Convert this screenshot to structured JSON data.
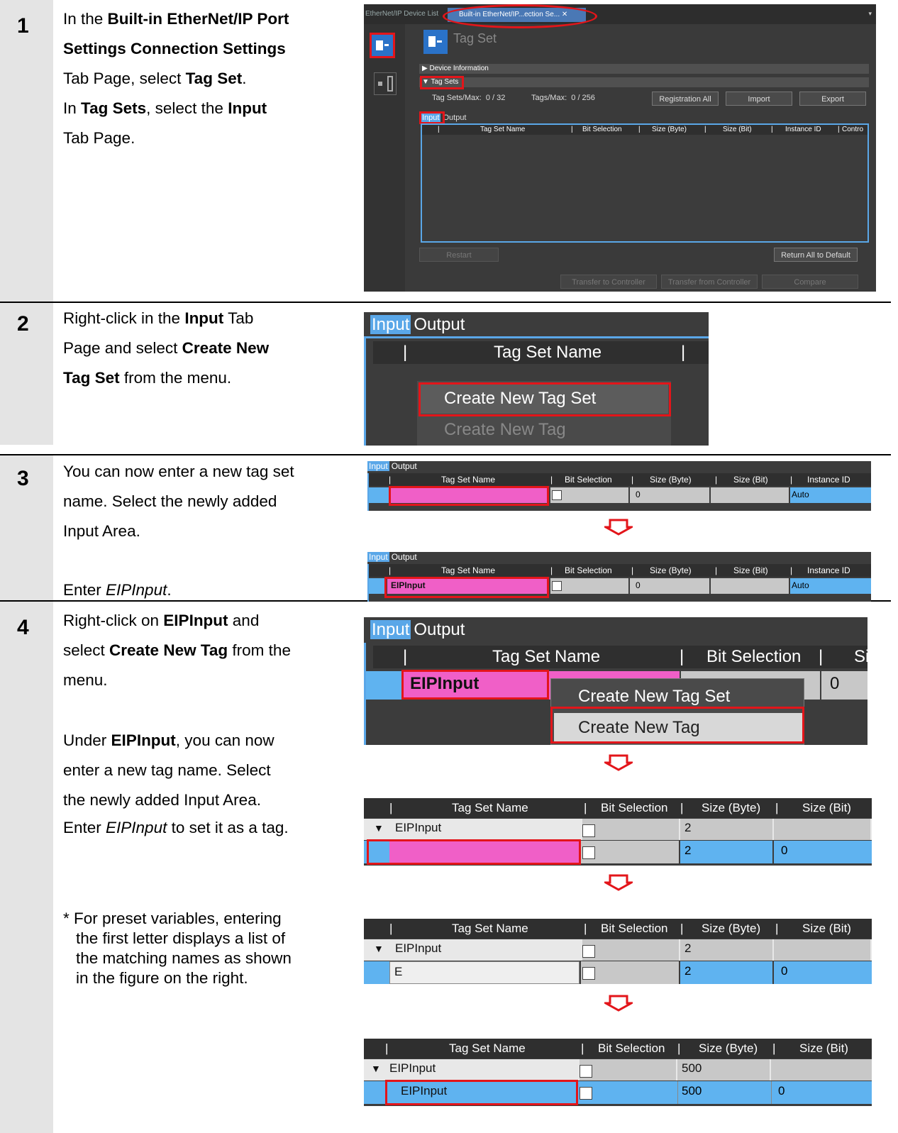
{
  "steps": [
    {
      "num": "1"
    },
    {
      "num": "2"
    },
    {
      "num": "3"
    },
    {
      "num": "4"
    }
  ],
  "step1": {
    "line1_a": "In the ",
    "line1_b": "Built-in EtherNet/IP Port",
    "line2": "Settings Connection Settings",
    "line3_a": "Tab Page, select ",
    "line3_b": "Tag Set",
    "line3_c": ".",
    "line4_a": "In ",
    "line4_b": "Tag Sets",
    "line4_c": ", select the ",
    "line4_d": "Input",
    "line5": "Tab Page."
  },
  "step2": {
    "line1_a": "Right-click in the ",
    "line1_b": "Input",
    "line1_c": " Tab",
    "line2_a": "Page and select ",
    "line2_b": "Create New",
    "line3_a": "Tag Set",
    "line3_b": " from the menu."
  },
  "step3": {
    "line1": "You can now enter a new tag set",
    "line2": "name. Select the newly added",
    "line3": "Input Area.",
    "line4_a": "Enter ",
    "line4_b": "EIPInput",
    "line4_c": "."
  },
  "step4": {
    "line1_a": "Right-click on ",
    "line1_b": "EIPInput",
    "line1_c": " and",
    "line2_a": "select ",
    "line2_b": "Create New Tag",
    "line2_c": " from the",
    "line3": "menu.",
    "line4_a": "Under ",
    "line4_b": "EIPInput",
    "line4_c": ", you can now",
    "line5": "enter a new tag name. Select",
    "line6": "the newly added Input Area.",
    "line7_a": "Enter ",
    "line7_b": "EIPInput",
    "line7_c": " to set it as a tag.",
    "note1": "* For preset variables, entering",
    "note2": "  the first letter displays a list of",
    "note3": "  the matching names as shown",
    "note4": "  in the figure on the right."
  },
  "sysmac": {
    "tab1": "EtherNet/IP Device List",
    "tab2": "Built-in EtherNet/IP...ection Se...",
    "tab2_close": "✕",
    "page_title": "Tag Set",
    "device_info": "Device Information",
    "tag_sets": "Tag Sets",
    "tag_sets_max_label": "Tag Sets/Max:",
    "tag_sets_max_value": "0  /  32",
    "tags_max_label": "Tags/Max:",
    "tags_max_value": "0  /  256",
    "btn_registration_all": "Registration All",
    "btn_import": "Import",
    "btn_export": "Export",
    "tab_input": "Input",
    "tab_output": "Output",
    "col_tag_set_name": "Tag Set Name",
    "col_bit_selection": "Bit Selection",
    "col_size_byte": "Size (Byte)",
    "col_size_bit": "Size (Bit)",
    "col_instance_id": "Instance ID",
    "col_control": "Contro",
    "btn_restart": "Restart",
    "btn_return_default": "Return All to Default",
    "btn_transfer_to": "Transfer to Controller",
    "btn_transfer_from": "Transfer from Controller",
    "btn_compare": "Compare"
  },
  "shot2": {
    "tab_input": "Input",
    "tab_output": "Output",
    "col_name": "Tag Set Name",
    "menu_create_set": "Create New Tag Set",
    "menu_create_tag": "Create New Tag"
  },
  "shot3": {
    "tab_input": "Input",
    "tab_output": "Output",
    "col_name": "Tag Set Name",
    "col_bit": "Bit Selection",
    "col_byte": "Size (Byte)",
    "col_bitsize": "Size (Bit)",
    "col_inst": "Instance ID",
    "size_byte": "0",
    "instance": "Auto",
    "entered_name": "EIPInput"
  },
  "shot4": {
    "tab_input": "Input",
    "tab_output": "Output",
    "col_name": "Tag Set Name",
    "col_bit": "Bit Selection",
    "col_byte_partial": "Si",
    "row_name": "EIPInput",
    "row_byte": "0",
    "menu_create_set": "Create New Tag Set",
    "menu_create_tag": "Create New Tag"
  },
  "grid4": {
    "col_name": "Tag Set Name",
    "col_bit": "Bit Selection",
    "col_byte": "Size (Byte)",
    "col_bitsize": "Size (Bit)",
    "expand": "▼",
    "parent": "EIPInput",
    "size2": "2",
    "bit0": "0",
    "typed": "E",
    "size500": "500",
    "child": "EIPInput"
  }
}
